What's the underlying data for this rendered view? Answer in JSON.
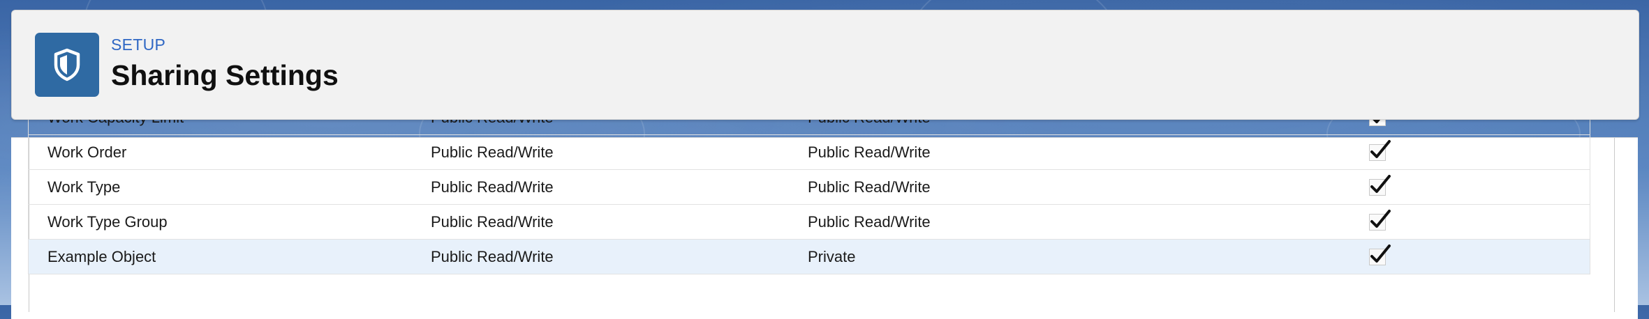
{
  "header": {
    "breadcrumb": "SETUP",
    "title": "Sharing Settings",
    "icon": "shield-icon"
  },
  "sharing_table": {
    "rows": [
      {
        "object": "Work Capacity Limit",
        "default_internal": "Public Read/Write",
        "default_external": "Public Read/Write",
        "grant_access_using_hierarchies": true,
        "highlighted": false,
        "partially_visible": true
      },
      {
        "object": "Work Order",
        "default_internal": "Public Read/Write",
        "default_external": "Public Read/Write",
        "grant_access_using_hierarchies": true,
        "highlighted": false
      },
      {
        "object": "Work Type",
        "default_internal": "Public Read/Write",
        "default_external": "Public Read/Write",
        "grant_access_using_hierarchies": true,
        "highlighted": false
      },
      {
        "object": "Work Type Group",
        "default_internal": "Public Read/Write",
        "default_external": "Public Read/Write",
        "grant_access_using_hierarchies": true,
        "highlighted": false
      },
      {
        "object": "Example Object",
        "default_internal": "Public Read/Write",
        "default_external": "Private",
        "grant_access_using_hierarchies": true,
        "highlighted": true
      }
    ]
  },
  "colors": {
    "background_blue": "#3f6cab",
    "icon_tile": "#2f6aa3",
    "breadcrumb_link": "#2f67c4",
    "row_highlight": "#e8f1fb"
  }
}
